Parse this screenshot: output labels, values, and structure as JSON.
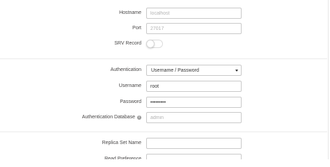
{
  "connection": {
    "hostname": {
      "label": "Hostname",
      "placeholder": "localhost",
      "value": ""
    },
    "port": {
      "label": "Port",
      "placeholder": "27017",
      "value": ""
    },
    "srv": {
      "label": "SRV Record",
      "enabled": false
    }
  },
  "auth": {
    "authentication": {
      "label": "Authentication",
      "selected": "Username / Password"
    },
    "username": {
      "label": "Username",
      "value": "root"
    },
    "password": {
      "label": "Password",
      "value": "•••••••••"
    },
    "auth_db": {
      "label": "Authentication Database",
      "placeholder": "admin",
      "value": "",
      "info_icon": "info-icon"
    }
  },
  "replica": {
    "replica_set_name": {
      "label": "Replica Set Name",
      "value": ""
    },
    "read_preference": {
      "label": "Read Preference"
    }
  }
}
